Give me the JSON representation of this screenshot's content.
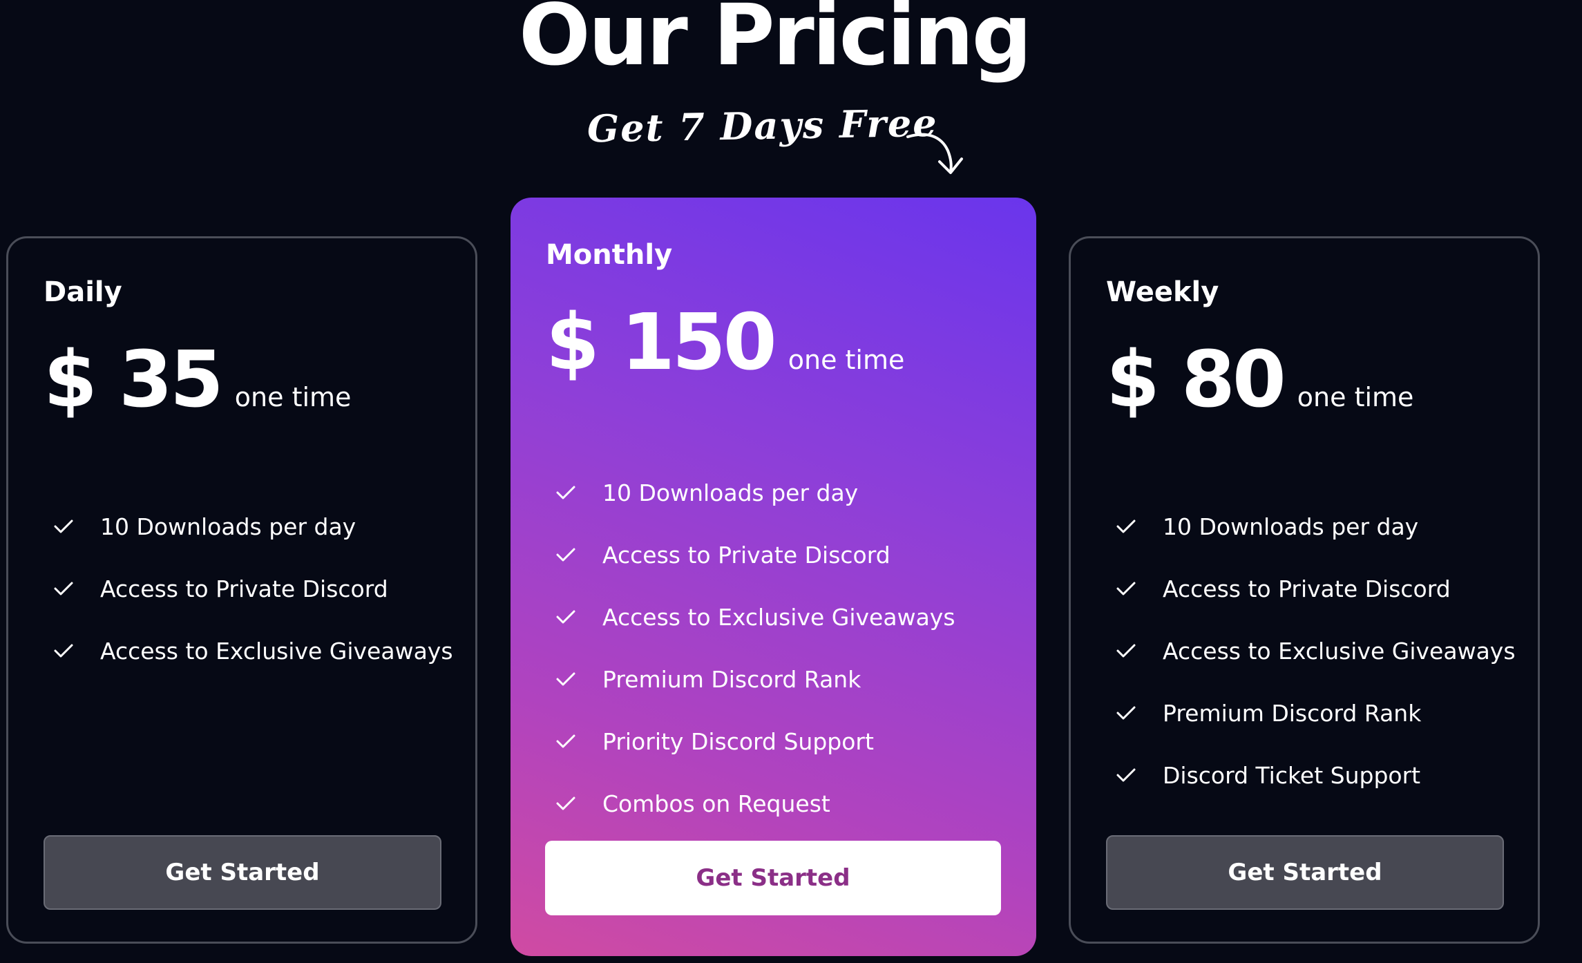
{
  "header": {
    "title": "Our Pricing",
    "subtitle": "Get 7 Days Free"
  },
  "plans": [
    {
      "name": "Daily",
      "currency": "$",
      "amount": "35",
      "period": "one time",
      "features": [
        "10 Downloads per day",
        "Access to Private Discord",
        "Access to Exclusive Giveaways"
      ],
      "cta_label": "Get Started"
    },
    {
      "name": "Monthly",
      "currency": "$",
      "amount": "150",
      "period": "one time",
      "features": [
        "10 Downloads per day",
        "Access to Private Discord",
        "Access to Exclusive Giveaways",
        "Premium Discord Rank",
        "Priority Discord Support",
        "Combos on Request"
      ],
      "cta_label": "Get Started"
    },
    {
      "name": "Weekly",
      "currency": "$",
      "amount": "80",
      "period": "one time",
      "features": [
        "10 Downloads per day",
        "Access to Private Discord",
        "Access to Exclusive Giveaways",
        "Premium Discord Rank",
        "Discord Ticket Support"
      ],
      "cta_label": "Get Started"
    }
  ],
  "colors": {
    "background": "#060915",
    "featured_gradient_top": "#6a35ec",
    "featured_gradient_bottom": "#d04ba2",
    "dark_button": "#474852",
    "featured_button_text": "#8b2f87"
  }
}
